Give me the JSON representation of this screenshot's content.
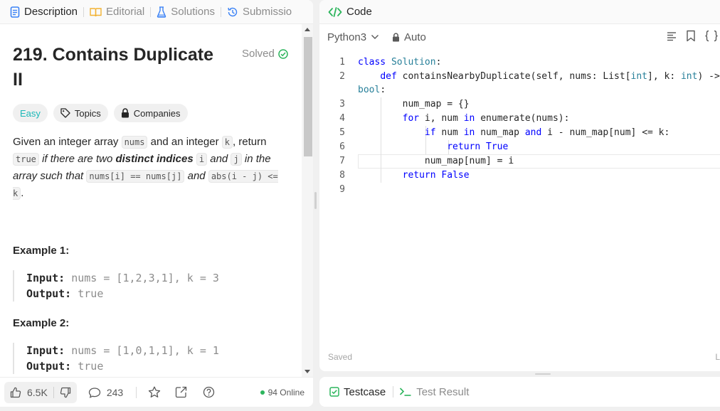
{
  "tabs": [
    {
      "label": "Description",
      "icon": "description-icon"
    },
    {
      "label": "Editorial",
      "icon": "book-icon"
    },
    {
      "label": "Solutions",
      "icon": "flask-icon"
    },
    {
      "label": "Submissio",
      "icon": "history-icon"
    }
  ],
  "problem": {
    "title": "219. Contains Duplicate II",
    "status": "Solved",
    "difficulty": "Easy",
    "topics_label": "Topics",
    "companies_label": "Companies",
    "description": {
      "p1": "Given an integer array ",
      "c_nums": "nums",
      "p2": " and an integer ",
      "c_k": "k",
      "p3": ", return ",
      "c_true": "true",
      "p4": " if there are two ",
      "bold": "distinct indices",
      "c_i": "i",
      "p5": " and ",
      "c_j": "j",
      "p6": " in the array such that ",
      "c_eq": "nums[i] == nums[j]",
      "p7": " and ",
      "c_abs": "abs(i - j) <= k",
      "p8": "."
    },
    "examples": [
      {
        "title": "Example 1:",
        "input_label": "Input:",
        "input": "nums = [1,2,3,1], k = 3",
        "output_label": "Output:",
        "output": "true"
      },
      {
        "title": "Example 2:",
        "input_label": "Input:",
        "input": "nums = [1,0,1,1], k = 1",
        "output_label": "Output:",
        "output": "true"
      }
    ]
  },
  "bottom_bar": {
    "likes": "6.5K",
    "comments": "243",
    "online": "94 Online"
  },
  "code_panel": {
    "title": "Code",
    "language": "Python3",
    "mode": "Auto",
    "saved_label": "Saved",
    "line_indicator": "L",
    "line_numbers": [
      "1",
      "2",
      "3",
      "4",
      "5",
      "6",
      "7",
      "8",
      "9"
    ]
  },
  "console": {
    "testcase_label": "Testcase",
    "result_label": "Test Result"
  },
  "colors": {
    "accent_green": "#2db55d",
    "easy": "#1cb8b8",
    "keyword": "#0000ff",
    "class_name": "#267f99"
  }
}
